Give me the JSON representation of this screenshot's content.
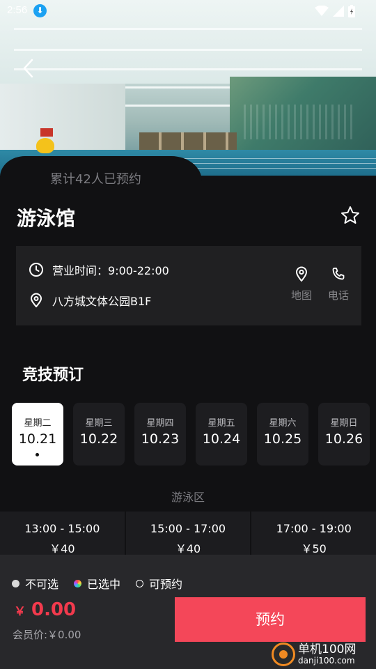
{
  "status_bar": {
    "time": "2:56",
    "download_glyph": "⬇"
  },
  "hero": {
    "booking_count": "累计42人已预约"
  },
  "venue": {
    "name": "游泳馆",
    "hours_label": "营业时间：",
    "hours": "9:00-22:00",
    "address": "八方城文体公园B1F",
    "map_label": "地图",
    "phone_label": "电话"
  },
  "booking": {
    "section_title": "竞技预订",
    "dates": [
      {
        "weekday": "星期二",
        "date": "10.21",
        "selected": true
      },
      {
        "weekday": "星期三",
        "date": "10.22",
        "selected": false
      },
      {
        "weekday": "星期四",
        "date": "10.23",
        "selected": false
      },
      {
        "weekday": "星期五",
        "date": "10.24",
        "selected": false
      },
      {
        "weekday": "星期六",
        "date": "10.25",
        "selected": false
      },
      {
        "weekday": "星期日",
        "date": "10.26",
        "selected": false
      }
    ],
    "zone": "游泳区",
    "slots": [
      {
        "time": "13:00 - 15:00",
        "price": "￥40"
      },
      {
        "time": "15:00 - 17:00",
        "price": "￥40"
      },
      {
        "time": "17:00 - 19:00",
        "price": "￥50"
      }
    ]
  },
  "legend": {
    "unavailable": "不可选",
    "selected": "已选中",
    "available": "可预约"
  },
  "checkout": {
    "currency": "￥",
    "total": "0.00",
    "member_price": "会员价:￥0.00",
    "book_label": "预约"
  },
  "watermark": {
    "name": "单机100网",
    "domain": "danji100.com"
  },
  "colors": {
    "accent": "#f44759",
    "price": "#f23a4d",
    "background": "#111113",
    "card": "#202022"
  },
  "icons": [
    "back-icon",
    "star-icon",
    "clock-icon",
    "location-icon",
    "map-pin-icon",
    "phone-icon",
    "wifi-icon",
    "signal-icon",
    "battery-icon",
    "download-icon"
  ]
}
